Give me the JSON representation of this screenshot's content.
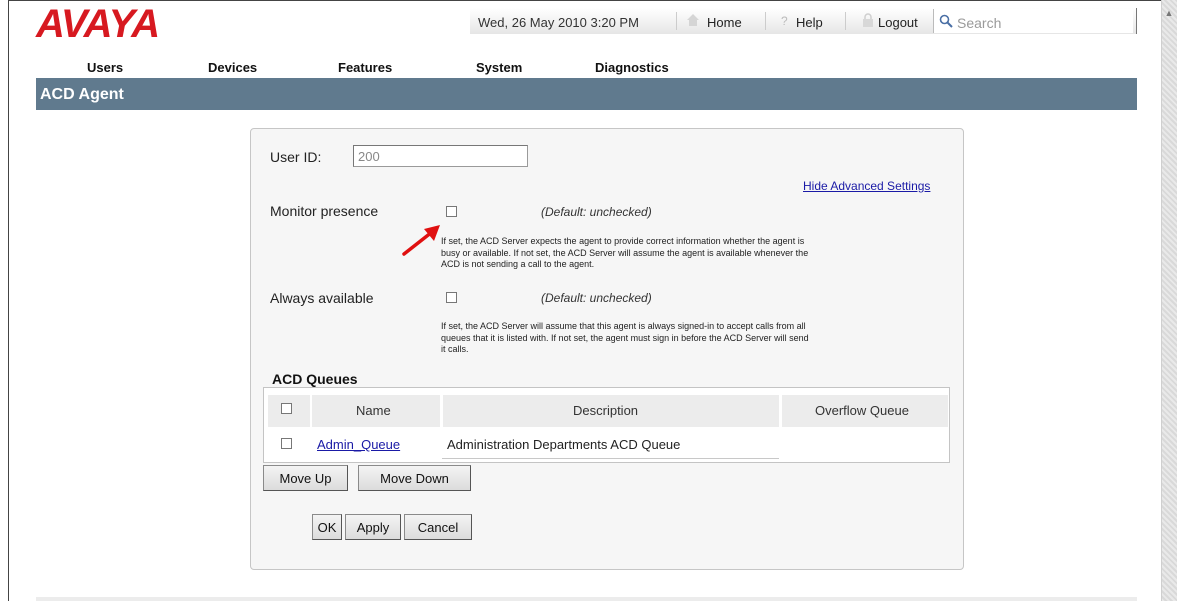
{
  "header": {
    "logo": "AVAYA",
    "date": "Wed, 26 May 2010 3:20 PM",
    "home_label": "Home",
    "help_label": "Help",
    "logout_label": "Logout",
    "search_placeholder": "Search",
    "icons": {
      "home": "home-icon",
      "help": "help-icon",
      "logout": "lock-icon",
      "search": "search-icon"
    }
  },
  "nav": {
    "items": [
      {
        "label": "Users"
      },
      {
        "label": "Devices"
      },
      {
        "label": "Features"
      },
      {
        "label": "System"
      },
      {
        "label": "Diagnostics"
      }
    ]
  },
  "page": {
    "title": "ACD Agent"
  },
  "form": {
    "user_id_label": "User ID:",
    "user_id_value": "200",
    "advanced_link": "Hide Advanced Settings",
    "monitor_presence": {
      "label": "Monitor presence",
      "checked": false,
      "default_note": "(Default: unchecked)",
      "help_lines": [
        "If set, the ACD Server expects the agent to provide correct information whether the agent is",
        "busy or available. If not set, the ACD Server will assume the agent is available whenever the",
        "ACD is not sending a call to the agent."
      ]
    },
    "always_available": {
      "label": "Always available",
      "checked": false,
      "default_note": "(Default: unchecked)",
      "help_lines": [
        "If set, the ACD Server will assume that this agent is always signed-in to accept calls from all",
        "queues that it is listed with. If not set, the agent must sign in before the ACD Server will send",
        "it calls."
      ]
    }
  },
  "queues": {
    "title": "ACD Queues",
    "columns": [
      "Name",
      "Description",
      "Overflow Queue"
    ],
    "rows": [
      {
        "name": "Admin_Queue",
        "description": "Administration Departments ACD Queue",
        "overflow": ""
      }
    ]
  },
  "buttons": {
    "move_up": "Move Up",
    "move_down": "Move Down",
    "ok": "OK",
    "apply": "Apply",
    "cancel": "Cancel"
  },
  "colors": {
    "brand_red": "#d71920",
    "title_bar": "#607a8e",
    "link": "#1a1aa6",
    "annotation_arrow": "#e01010"
  }
}
